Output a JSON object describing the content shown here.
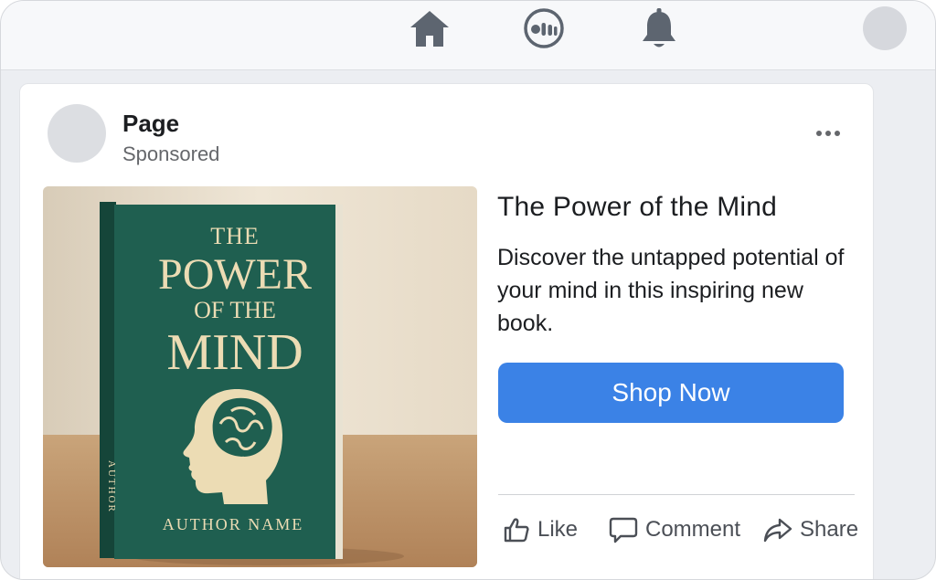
{
  "nav": {
    "items": [
      "home-icon",
      "messenger-icon",
      "bell-icon"
    ],
    "icon_color": "#5d6570"
  },
  "post": {
    "page_name": "Page",
    "sponsored_label": "Sponsored",
    "more_icon": "more-dots-icon",
    "image": {
      "book_title_line1": "THE",
      "book_title_line2": "POWER",
      "book_title_line3": "OF THE",
      "book_title_line4": "MIND",
      "spine_text": "AUTHOR",
      "author": "AUTHOR NAME",
      "cover_color": "#1f5f50",
      "text_color": "#ecdcb4"
    },
    "ad_title": "The Power of the Mind",
    "ad_description": "Discover the untapped potential of your mind in this inspiring new book.",
    "cta_label": "Shop Now",
    "cta_color": "#3b82e6",
    "actions": {
      "like": "Like",
      "comment": "Comment",
      "share": "Share"
    }
  }
}
